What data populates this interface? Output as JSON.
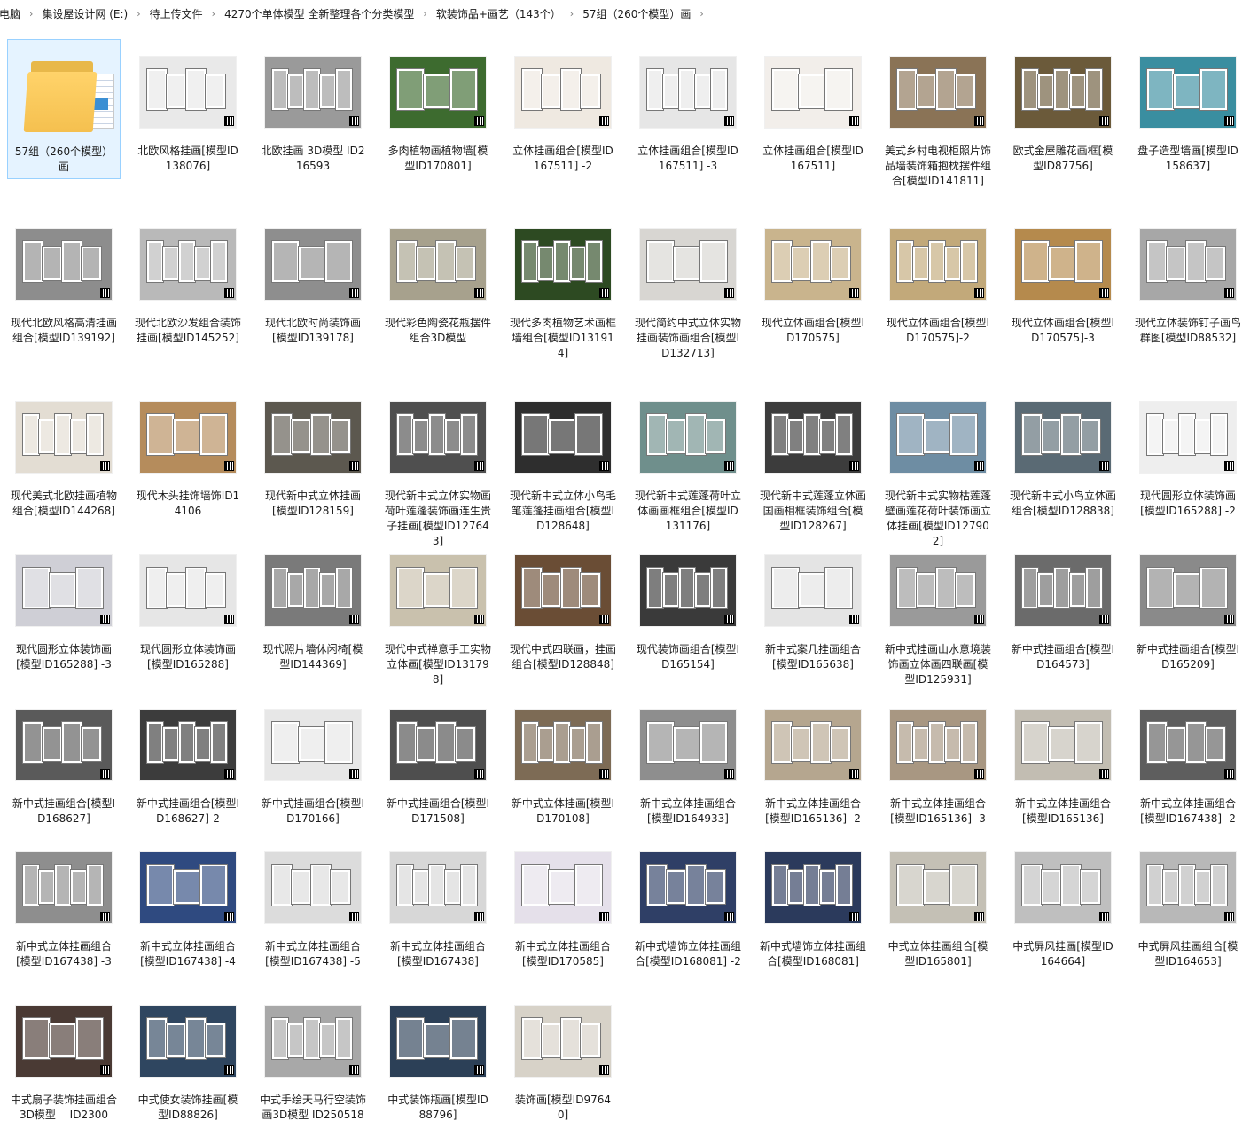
{
  "breadcrumb": [
    "电脑",
    "集设屋设计网 (E:)",
    "待上传文件",
    "4270个单体模型 全新整理各个分类模型",
    "软装饰品+画艺（143个）",
    "57组（260个模型）画"
  ],
  "breadcrumb_separator": "›",
  "items": [
    {
      "label": "57组（260个模型）画",
      "kind": "folder"
    },
    {
      "label": "北欧风格挂画[模型ID138076]",
      "bg": "#e9e9e9"
    },
    {
      "label": "北欧挂画 3D模型 ID216593",
      "bg": "#9a9a9a"
    },
    {
      "label": "多肉植物画植物墙[模型ID170801]",
      "bg": "#3d6b2f"
    },
    {
      "label": "立体挂画组合[模型ID167511] -2",
      "bg": "#efe9e1"
    },
    {
      "label": "立体挂画组合[模型ID167511] -3",
      "bg": "#e6e6e6"
    },
    {
      "label": "立体挂画组合[模型ID167511]",
      "bg": "#f2eeea"
    },
    {
      "label": "美式乡村电视柜照片饰品墙装饰箱抱枕摆件组合[模型ID141811]",
      "bg": "#8a7356"
    },
    {
      "label": "欧式金屋雕花画框[模型ID87756]",
      "bg": "#6b5a3a"
    },
    {
      "label": "盘子造型墙画[模型ID158637]",
      "bg": "#3a8ea0"
    },
    {
      "label": "现代北欧风格高清挂画组合[模型ID139192]",
      "bg": "#8d8d8d"
    },
    {
      "label": "现代北欧沙发组合装饰挂画[模型ID145252]",
      "bg": "#b9b9b9"
    },
    {
      "label": "现代北欧时尚装饰画[模型ID139178]",
      "bg": "#8e8e8e"
    },
    {
      "label": "现代彩色陶瓷花瓶摆件组合3D模型",
      "bg": "#a7a18d"
    },
    {
      "label": "现代多肉植物艺术画框墙组合[模型ID131914]",
      "bg": "#2d4a22"
    },
    {
      "label": "现代简约中式立体实物挂画装饰画组合[模型ID132713]",
      "bg": "#d8d6d2"
    },
    {
      "label": "现代立体画组合[模型ID170575]",
      "bg": "#c9b48d"
    },
    {
      "label": "现代立体画组合[模型ID170575]-2",
      "bg": "#c2a97a"
    },
    {
      "label": "现代立体画组合[模型ID170575]-3",
      "bg": "#b58a4d"
    },
    {
      "label": "现代立体装饰钉子画鸟群图[模型ID88532]",
      "bg": "#a7a7a7"
    },
    {
      "label": "现代美式北欧挂画植物组合[模型ID144268]",
      "bg": "#e3ddd3"
    },
    {
      "label": "现代木头挂饰墙饰ID14106",
      "bg": "#b58c5c"
    },
    {
      "label": "现代新中式立体挂画[模型ID128159]",
      "bg": "#5c584f"
    },
    {
      "label": "现代新中式立体实物画荷叶莲蓬装饰画连生贵子挂画[模型ID127643]",
      "bg": "#4f4f4f"
    },
    {
      "label": "现代新中式立体小鸟毛笔莲蓬挂画组合[模型ID128648]",
      "bg": "#2e2e2e"
    },
    {
      "label": "现代新中式莲蓬荷叶立体画画框组合[模型ID131176]",
      "bg": "#6f8f8c"
    },
    {
      "label": "现代新中式莲蓬立体画国画相框装饰组合[模型ID128267]",
      "bg": "#3c3c3c"
    },
    {
      "label": "现代新中式实物枯莲蓬壁画莲花荷叶装饰画立体挂画[模型ID127902]",
      "bg": "#6e8da3"
    },
    {
      "label": "现代新中式小鸟立体画组合[模型ID128838]",
      "bg": "#5a6a74"
    },
    {
      "label": "现代圆形立体装饰画[模型ID165288] -2",
      "bg": "#eeeeee"
    },
    {
      "label": "现代圆形立体装饰画[模型ID165288] -3",
      "bg": "#cfcfd6"
    },
    {
      "label": "现代圆形立体装饰画[模型ID165288]",
      "bg": "#e6e6e6"
    },
    {
      "label": "现代照片墙休闲椅[模型ID144369]",
      "bg": "#7a7a7a"
    },
    {
      "label": "现代中式禅意手工实物立体画[模型ID131798]",
      "bg": "#c9c1ad"
    },
    {
      "label": "现代中式四联画，挂画组合[模型ID128848]",
      "bg": "#6a4d35"
    },
    {
      "label": "现代装饰画组合[模型ID165154]",
      "bg": "#3a3a3a"
    },
    {
      "label": "新中式案几挂画组合[模型ID165638]",
      "bg": "#e4e4e4"
    },
    {
      "label": "新中式挂画山水意境装饰画立体画四联画[模型ID125931]",
      "bg": "#9a9a9a"
    },
    {
      "label": "新中式挂画组合[模型ID164573]",
      "bg": "#6b6b6b"
    },
    {
      "label": "新中式挂画组合[模型ID165209]",
      "bg": "#8a8a8a"
    },
    {
      "label": "新中式挂画组合[模型ID168627]",
      "bg": "#5a5a5a"
    },
    {
      "label": "新中式挂画组合[模型ID168627]-2",
      "bg": "#3c3c3c"
    },
    {
      "label": "新中式挂画组合[模型ID170166]",
      "bg": "#e7e7e7"
    },
    {
      "label": "新中式挂画组合[模型ID171508]",
      "bg": "#4e4e4e"
    },
    {
      "label": "新中式立体挂画[模型ID170108]",
      "bg": "#7d6b55"
    },
    {
      "label": "新中式立体挂画组合[模型ID164933]",
      "bg": "#8e8e8e"
    },
    {
      "label": "新中式立体挂画组合[模型ID165136] -2",
      "bg": "#b5a68f"
    },
    {
      "label": "新中式立体挂画组合[模型ID165136] -3",
      "bg": "#a89782"
    },
    {
      "label": "新中式立体挂画组合[模型ID165136]",
      "bg": "#c2bdb2"
    },
    {
      "label": "新中式立体挂画组合[模型ID167438] -2",
      "bg": "#5e5e5e"
    },
    {
      "label": "新中式立体挂画组合[模型ID167438] -3",
      "bg": "#8e8e8e"
    },
    {
      "label": "新中式立体挂画组合[模型ID167438] -4",
      "bg": "#2f4a80"
    },
    {
      "label": "新中式立体挂画组合[模型ID167438] -5",
      "bg": "#dcdcdc"
    },
    {
      "label": "新中式立体挂画组合[模型ID167438]",
      "bg": "#d7d7d7"
    },
    {
      "label": "新中式立体挂画组合[模型ID170585]",
      "bg": "#e5e0ea"
    },
    {
      "label": "新中式墙饰立体挂画组合[模型ID168081] -2",
      "bg": "#2f3f66"
    },
    {
      "label": "新中式墙饰立体挂画组合[模型ID168081]",
      "bg": "#2b3a5c"
    },
    {
      "label": "中式立体挂画组合[模型ID165801]",
      "bg": "#c4c0b5"
    },
    {
      "label": "中式屏风挂画[模型ID164664]",
      "bg": "#bfbfbf"
    },
    {
      "label": "中式屏风挂画组合[模型ID164653]",
      "bg": "#b8b8b8"
    },
    {
      "label": "中式扇子装饰挂画组合3D模型　 ID2300",
      "bg": "#4a3a34"
    },
    {
      "label": "中式使女装饰挂画[模型ID88826]",
      "bg": "#2f4660"
    },
    {
      "label": "中式手绘天马行空装饰画3D模型 ID250518",
      "bg": "#a8a8a8"
    },
    {
      "label": "中式装饰瓶画[模型ID88796]",
      "bg": "#2c4057"
    },
    {
      "label": "装饰画[模型ID97640]",
      "bg": "#d7d2c8"
    }
  ]
}
